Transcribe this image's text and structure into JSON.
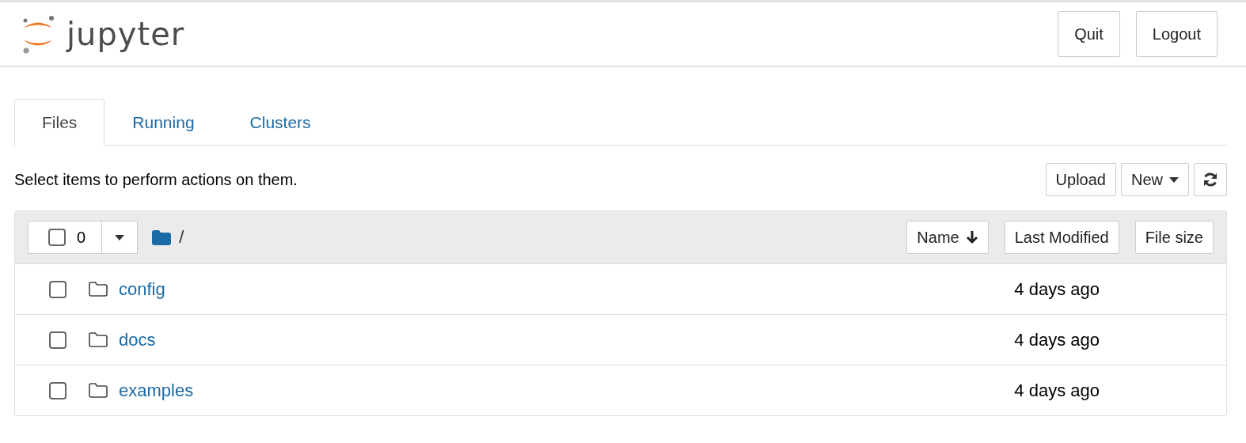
{
  "header": {
    "logo_text": "jupyter",
    "buttons": [
      "Quit",
      "Logout"
    ]
  },
  "tabs": [
    {
      "label": "Files",
      "selected": true
    },
    {
      "label": "Running",
      "selected": false
    },
    {
      "label": "Clusters",
      "selected": false
    }
  ],
  "hint": "Select items to perform actions on them.",
  "toolbar": {
    "upload": "Upload",
    "new": "New"
  },
  "listing": {
    "select_all": {
      "checked": false,
      "count": "0"
    },
    "path": "/",
    "columns": [
      {
        "label": "Name",
        "sorted": true
      },
      {
        "label": "Last Modified",
        "sorted": false
      },
      {
        "label": "File size",
        "sorted": false
      }
    ],
    "rows": [
      {
        "name": "config",
        "modified": "4 days ago",
        "checked": false
      },
      {
        "name": "docs",
        "modified": "4 days ago",
        "checked": false
      },
      {
        "name": "examples",
        "modified": "4 days ago",
        "checked": false
      }
    ]
  }
}
